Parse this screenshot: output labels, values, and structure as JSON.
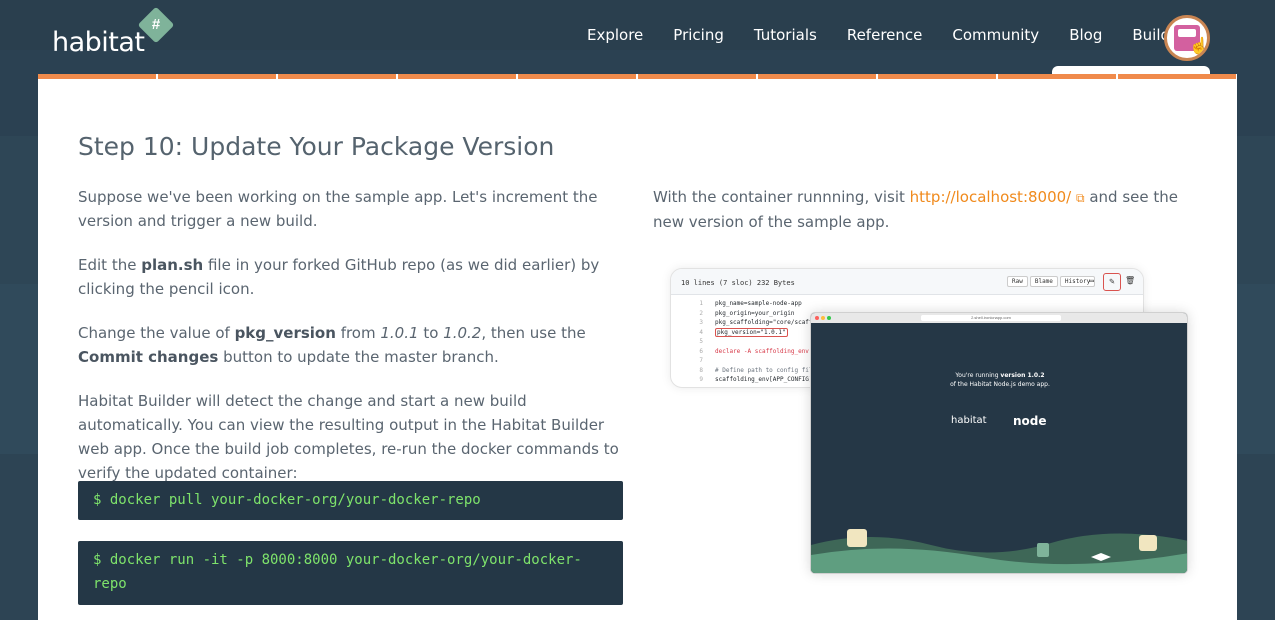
{
  "header": {
    "logo_text": "habitat",
    "nav": [
      "Explore",
      "Pricing",
      "Tutorials",
      "Reference",
      "Community",
      "Blog",
      "Builder"
    ]
  },
  "content": {
    "title": "Step 10: Update Your Package Version",
    "p1": "Suppose we've been working on the sample app. Let's increment the version and trigger a new build.",
    "p2_a": "Edit the ",
    "p2_file": "plan.sh",
    "p2_b": " file in your forked GitHub repo (as we did earlier) by clicking the pencil icon.",
    "p3_a": "Change the value of ",
    "p3_key": "pkg_version",
    "p3_b": " from ",
    "p3_from": "1.0.1",
    "p3_c": " to ",
    "p3_to": "1.0.2",
    "p3_d": ", then use the ",
    "p3_btn": "Commit changes",
    "p3_e": " button to update the master branch.",
    "p4": "Habitat Builder will detect the change and start a new build automatically. You can view the resulting output in the Habitat Builder web app. Once the build job completes, re-run the docker commands to verify the updated container:",
    "code1": "$ docker pull your-docker-org/your-docker-repo",
    "code2": "$ docker run -it -p 8000:8000 your-docker-org/your-docker-repo",
    "right_a": "With the container runnning, visit ",
    "right_link": "http://localhost:8000/",
    "right_b": " and see the new version of the sample app."
  },
  "screenshot": {
    "meta": "10 lines (7 sloc)   232 Bytes",
    "buttons": [
      "Raw",
      "Blame",
      "History"
    ],
    "lines": [
      "pkg_name=sample-node-app",
      "pkg_origin=your_origin",
      "pkg_scaffolding=\"core/scaffolding-node\"",
      "pkg_version=\"1.0.1\"",
      "",
      "declare -A scaffolding_env",
      "",
      "# Define path to config file",
      "scaffolding_env[APP_CONFIG]=\"{{pkg.svc_config_path}}/config.json\""
    ],
    "url": "2.shell.ironicnapp.com",
    "running_a": "You're running ",
    "running_version": "version 1.0.2",
    "running_b": "of the Habitat Node.js demo app.",
    "hab_logo": "habitat",
    "node_logo": "node"
  }
}
